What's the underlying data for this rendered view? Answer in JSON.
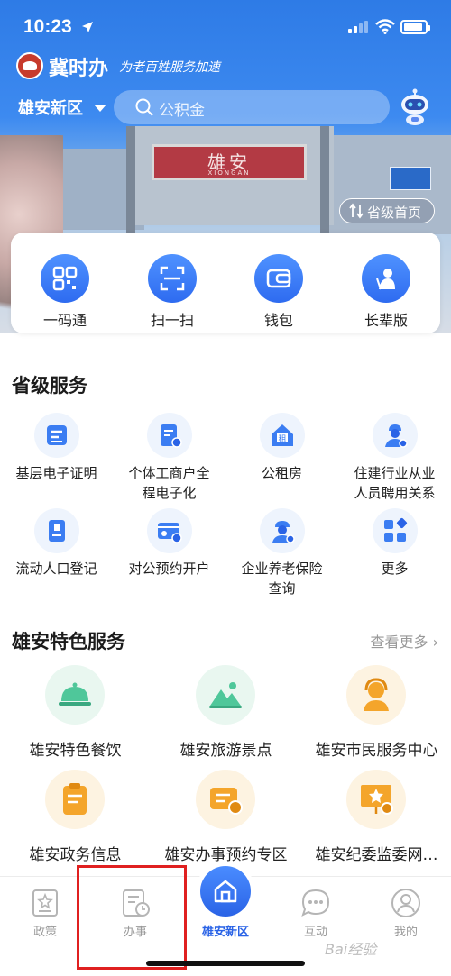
{
  "status_bar": {
    "time": "10:23"
  },
  "header": {
    "app_name": "冀时办",
    "slogan": "为老百姓服务加速"
  },
  "region": {
    "name": "雄安新区"
  },
  "search": {
    "placeholder": "公积金"
  },
  "banner": {
    "sign_title": "雄安",
    "sign_subtitle": "XIONGAN",
    "provincial_home": "省级首页"
  },
  "quick_actions": [
    {
      "label": "一码通",
      "icon": "qr-code-icon"
    },
    {
      "label": "扫一扫",
      "icon": "scan-icon"
    },
    {
      "label": "钱包",
      "icon": "wallet-icon"
    },
    {
      "label": "长辈版",
      "icon": "elder-icon"
    }
  ],
  "provincial_services": {
    "title": "省级服务",
    "items": [
      {
        "label_line1": "基层电子证明",
        "label_line2": "",
        "icon": "certificate-icon"
      },
      {
        "label_line1": "个体工商户全",
        "label_line2": "程电子化",
        "icon": "business-document-icon"
      },
      {
        "label_line1": "公租房",
        "label_line2": "",
        "icon": "rental-house-icon"
      },
      {
        "label_line1": "住建行业从业",
        "label_line2": "人员聘用关系",
        "icon": "construction-worker-icon"
      },
      {
        "label_line1": "流动人口登记",
        "label_line2": "",
        "icon": "registration-book-icon"
      },
      {
        "label_line1": "对公预约开户",
        "label_line2": "",
        "icon": "id-card-clock-icon"
      },
      {
        "label_line1": "企业养老保险",
        "label_line2": "查询",
        "icon": "elder-insurance-icon"
      },
      {
        "label_line1": "更多",
        "label_line2": "",
        "icon": "more-grid-icon"
      }
    ]
  },
  "featured_services": {
    "title": "雄安特色服务",
    "more_label": "查看更多",
    "items": [
      {
        "label": "雄安特色餐饮",
        "icon": "food-cloche-icon"
      },
      {
        "label": "雄安旅游景点",
        "icon": "mountain-icon"
      },
      {
        "label": "雄安市民服务中心",
        "icon": "service-agent-icon"
      },
      {
        "label": "雄安政务信息",
        "icon": "clipboard-icon"
      },
      {
        "label": "雄安办事预约专区",
        "icon": "appointment-icon"
      },
      {
        "label": "雄安纪委监委网…",
        "icon": "award-board-icon"
      }
    ]
  },
  "bottom_nav": [
    {
      "label": "政策",
      "icon": "policy-icon"
    },
    {
      "label": "办事",
      "icon": "tasks-clock-icon"
    },
    {
      "label": "雄安新区",
      "icon": "home-icon"
    },
    {
      "label": "互动",
      "icon": "chat-icon"
    },
    {
      "label": "我的",
      "icon": "user-icon"
    }
  ],
  "watermark": "Bai经验",
  "colors": {
    "primary": "#2e6bf0",
    "highlight_box": "#e02020",
    "featured_green": "#4fc79a",
    "featured_orange": "#f4a52b"
  }
}
